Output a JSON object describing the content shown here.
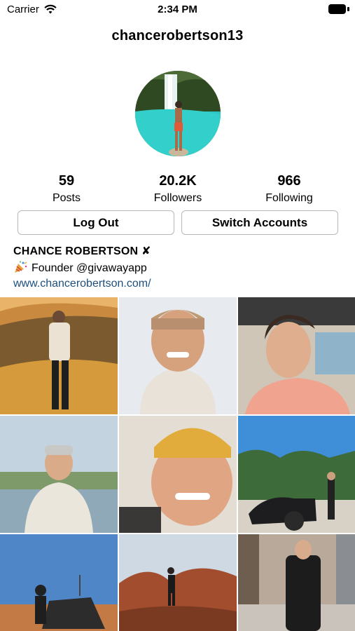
{
  "status_bar": {
    "carrier": "Carrier",
    "time": "2:34 PM"
  },
  "profile": {
    "username": "chancerobertson13",
    "display_name": "CHANCE ROBERTSON ✘",
    "bio": "Founder @givawayapp",
    "website": "www.chancerobertson.com/"
  },
  "stats": {
    "posts": {
      "value": "59",
      "label": "Posts"
    },
    "followers": {
      "value": "20.2K",
      "label": "Followers"
    },
    "following": {
      "value": "966",
      "label": "Following"
    }
  },
  "buttons": {
    "log_out": "Log Out",
    "switch_accounts": "Switch Accounts"
  },
  "icons": [
    "wifi-icon",
    "battery-icon",
    "party-popper-icon"
  ],
  "colors": {
    "link": "#1d4f7c",
    "button_border": "#b8b8b8"
  }
}
